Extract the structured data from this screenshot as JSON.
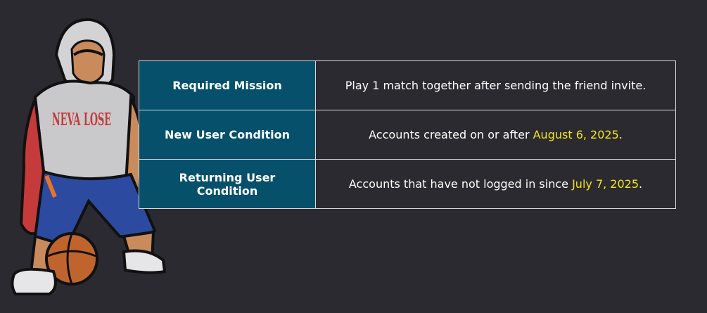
{
  "colors": {
    "background": "#2b2a30",
    "label_cell": "#06506b",
    "highlight": "#f6e61b",
    "text": "#ffffff",
    "border": "#d8d8dc"
  },
  "mascot": {
    "icon": "basketball-player-illustration",
    "jersey_text": "NEVA LOSE"
  },
  "table": {
    "rows": [
      {
        "label": "Required Mission",
        "value_before": "Play 1 match together after sending the friend invite.",
        "value_highlight": "",
        "value_after": ""
      },
      {
        "label": "New User Condition",
        "value_before": "Accounts created on or after ",
        "value_highlight": "August 6, 2025",
        "value_after": "."
      },
      {
        "label": "Returning User Condition",
        "value_before": "Accounts that have not logged in since ",
        "value_highlight": "July 7, 2025",
        "value_after": "."
      }
    ]
  }
}
